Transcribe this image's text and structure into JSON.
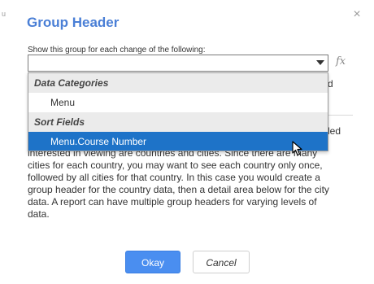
{
  "dialog": {
    "title": "Group Header",
    "close_glyph": "×",
    "edge_mark": "u"
  },
  "group_field": {
    "label": "Show this group for each change of the following:",
    "value": "",
    "fx_label": "fx"
  },
  "dropdown": {
    "groups": [
      {
        "label": "Data Categories",
        "options": [
          "Menu"
        ]
      },
      {
        "label": "Sort Fields",
        "options": [
          "Menu.Course Number"
        ]
      }
    ],
    "selected": "Menu.Course Number"
  },
  "background": {
    "partial_d": "d",
    "partial_ed": "led"
  },
  "description": "interested in viewing are countries and cities. Since there are many cities for each country, you may want to see each country only once, followed by all cities for that country. In this case you would create a group header for the country data, then a detail area below for the city data. A report can have multiple group headers for varying levels of data.",
  "buttons": {
    "ok": "Okay",
    "cancel": "Cancel"
  },
  "colors": {
    "title": "#4a7fd6",
    "selected_bg": "#1e73c8",
    "ok_bg": "#4a8ef0"
  },
  "icons": [
    "close-icon",
    "dropdown-arrow-icon",
    "fx-icon",
    "mouse-cursor-icon"
  ]
}
